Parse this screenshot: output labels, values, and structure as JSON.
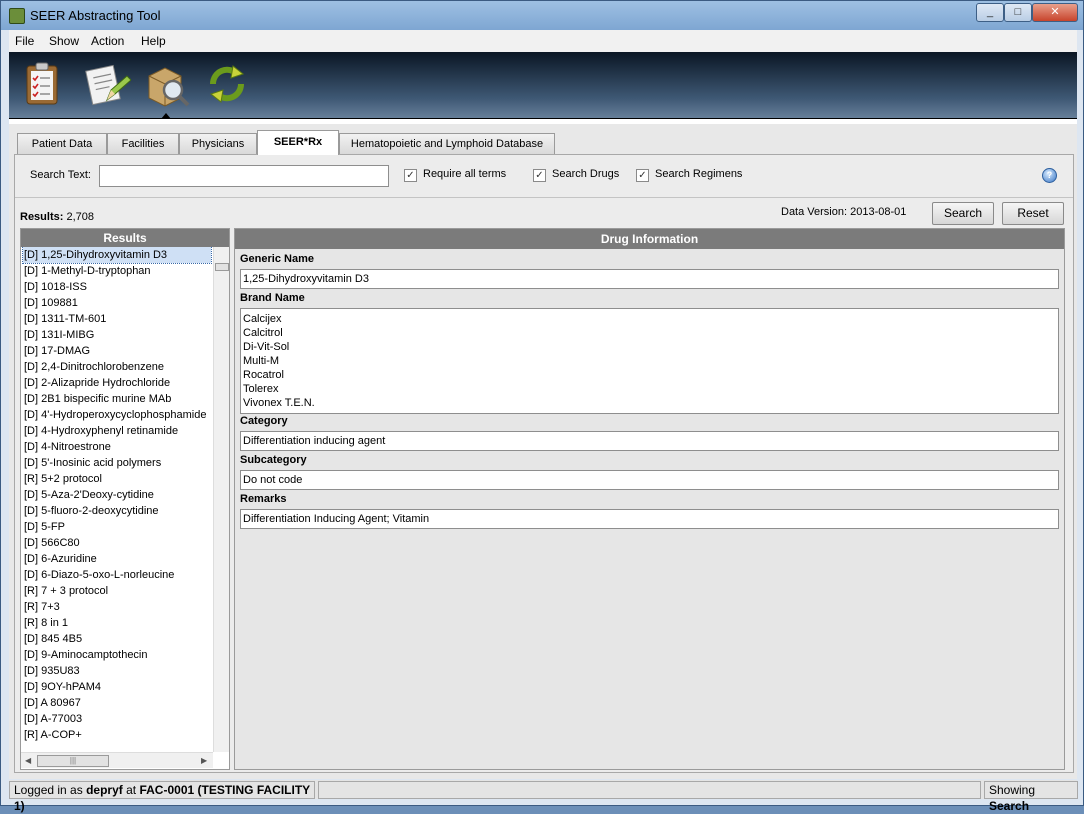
{
  "window": {
    "title": "SEER Abstracting Tool"
  },
  "menu": {
    "file": "File",
    "show": "Show",
    "action": "Action",
    "help": "Help"
  },
  "toolbar": {
    "icons": [
      "clipboard-checklist-icon",
      "notepad-pencil-icon",
      "box-magnifier-icon",
      "refresh-arrows-icon"
    ]
  },
  "tabs": [
    "Patient Data",
    "Facilities",
    "Physicians",
    "SEER*Rx",
    "Hematopoietic and Lymphoid Database"
  ],
  "search": {
    "label": "Search Text:",
    "value": "",
    "require_all": "Require all terms",
    "search_drugs": "Search Drugs",
    "search_regimens": "Search Regimens"
  },
  "results": {
    "label": "Results:",
    "count": "2,708",
    "header": "Results",
    "items": [
      "[D] 1,25-Dihydroxyvitamin D3",
      "[D] 1-Methyl-D-tryptophan",
      "[D] 1018-ISS",
      "[D] 109881",
      "[D] 1311-TM-601",
      "[D] 131I-MIBG",
      "[D] 17-DMAG",
      "[D] 2,4-Dinitrochlorobenzene",
      "[D] 2-Alizapride Hydrochloride",
      "[D] 2B1 bispecific murine MAb",
      "[D] 4'-Hydroperoxycyclophosphamide",
      "[D] 4-Hydroxyphenyl retinamide",
      "[D] 4-Nitroestrone",
      "[D] 5'-Inosinic acid polymers",
      "[R] 5+2 protocol",
      "[D] 5-Aza-2'Deoxy-cytidine",
      "[D] 5-fluoro-2-deoxycytidine",
      "[D] 5-FP",
      "[D] 566C80",
      "[D] 6-Azuridine",
      "[D] 6-Diazo-5-oxo-L-norleucine",
      "[R] 7 + 3 protocol",
      "[R] 7+3",
      "[R] 8 in 1",
      "[D] 845 4B5",
      "[D] 9-Aminocamptothecin",
      "[D] 935U83",
      "[D] 9OY-hPAM4",
      "[D] A 80967",
      "[D] A-77003",
      "[R] A-COP+"
    ]
  },
  "data_version": "Data Version: 2013-08-01",
  "buttons": {
    "search": "Search",
    "reset": "Reset"
  },
  "drug_info": {
    "header": "Drug Information",
    "generic_label": "Generic Name",
    "generic_value": "1,25-Dihydroxyvitamin D3",
    "brand_label": "Brand Name",
    "brands": [
      "Calcijex",
      "Calcitrol",
      "Di-Vit-Sol",
      "Multi-M",
      "Rocatrol",
      "Tolerex",
      "Vivonex T.E.N."
    ],
    "category_label": "Category",
    "category_value": "Differentiation inducing agent",
    "subcategory_label": "Subcategory",
    "subcategory_value": "Do not code",
    "remarks_label": "Remarks",
    "remarks_value": "Differentiation Inducing Agent; Vitamin"
  },
  "status": {
    "logged_prefix": "Logged in as",
    "user": "depryf",
    "at": "at",
    "facility": "FAC-0001 (TESTING FACILITY 1)",
    "showing_prefix": "Showing",
    "showing_value": "Search"
  }
}
